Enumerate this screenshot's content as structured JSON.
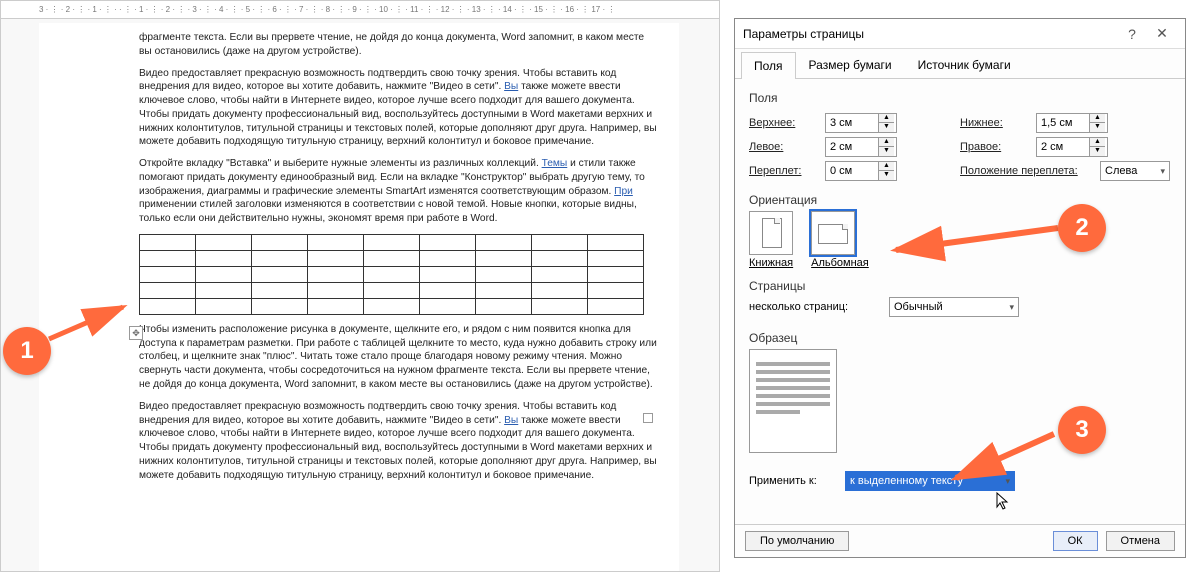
{
  "ruler": {
    "visible_marks": "3 · ⋮ · 2 · ⋮ · 1 · ⋮ ·  · ⋮ · 1 · ⋮ · 2 · ⋮ · 3 · ⋮ · 4 · ⋮ · 5 · ⋮ · 6 · ⋮ · 7 · ⋮ · 8 · ⋮ · 9 · ⋮ · 10 · ⋮ · 11 · ⋮ · 12 · ⋮ · 13 · ⋮ · 14 · ⋮ · 15 · ⋮ · 16 · ⋮ 17 · ⋮"
  },
  "document": {
    "para1": "фрагменте текста. Если вы прервете чтение, не дойдя до конца документа, Word запомнит, в каком месте вы остановились (даже на другом устройстве).",
    "para2_a": "Видео предоставляет прекрасную возможность подтвердить свою точку зрения. Чтобы вставить код внедрения для видео, которое вы хотите добавить, нажмите \"Видео в сети\". ",
    "para2_link": "Вы",
    "para2_b": " также можете ввести ключевое слово, чтобы найти в Интернете видео, которое лучше всего подходит для вашего документа. Чтобы придать документу профессиональный вид, воспользуйтесь доступными в Word макетами верхних и нижних колонтитулов, титульной страницы и текстовых полей, которые дополняют друг друга. Например, вы можете добавить подходящую титульную страницу, верхний колонтитул и боковое примечание.",
    "para3_a": "Откройте вкладку \"Вставка\" и выберите нужные элементы из различных коллекций. ",
    "para3_link": "Темы",
    "para3_b": " и стили также помогают придать документу единообразный вид. Если на вкладке \"Конструктор\" выбрать другую тему, то изображения, диаграммы и графические элементы SmartArt изменятся соответствующим образом. ",
    "para3_link2": "При",
    "para3_c": " применении стилей заголовки изменяются в соответствии с новой темой. Новые кнопки, которые видны, только если они действительно нужны, экономят время при работе в Word.",
    "para4": "Чтобы изменить расположение рисунка в документе, щелкните его, и рядом с ним появится кнопка для доступа к параметрам разметки. При работе с таблицей щелкните то место, куда нужно добавить строку или столбец, и щелкните знак \"плюс\". Читать тоже стало проще благодаря новому режиму чтения. Можно свернуть части документа, чтобы сосредоточиться на нужном фрагменте текста. Если вы прервете чтение, не дойдя до конца документа, Word запомнит, в каком месте вы остановились (даже на другом устройстве).",
    "para5_a": "Видео предоставляет прекрасную возможность подтвердить свою точку зрения. Чтобы вставить код внедрения для видео, которое вы хотите добавить, нажмите \"Видео в сети\". ",
    "para5_link": "Вы",
    "para5_b": " также можете ввести ключевое слово, чтобы найти в Интернете видео, которое лучше всего подходит для вашего документа. Чтобы придать документу профессиональный вид, воспользуйтесь доступными в Word макетами верхних и нижних колонтитулов, титульной страницы и текстовых полей, которые дополняют друг друга. Например, вы можете добавить подходящую титульную страницу, верхний колонтитул и боковое примечание."
  },
  "dialog": {
    "title": "Параметры страницы",
    "help": "?",
    "close": "✕",
    "tabs": {
      "t1": "Поля",
      "t2": "Размер бумаги",
      "t3": "Источник бумаги"
    },
    "sect_margins": "Поля",
    "top_label": "Верхнее:",
    "top_val": "3 см",
    "bottom_label": "Нижнее:",
    "bottom_val": "1,5 см",
    "left_label": "Левое:",
    "left_val": "2 см",
    "right_label": "Правое:",
    "right_val": "2 см",
    "gutter_label": "Переплет:",
    "gutter_val": "0 см",
    "gutter_pos_label": "Положение переплета:",
    "gutter_pos_val": "Слева",
    "sect_orient": "Ориентация",
    "orient_portrait": "Книжная",
    "orient_landscape": "Альбомная",
    "sect_pages": "Страницы",
    "multi_pages_label": "несколько страниц:",
    "multi_pages_val": "Обычный",
    "sect_preview": "Образец",
    "apply_label": "Применить к:",
    "apply_val": "к выделенному тексту",
    "btn_default": "По умолчанию",
    "btn_ok": "ОК",
    "btn_cancel": "Отмена"
  },
  "callouts": {
    "c1": "1",
    "c2": "2",
    "c3": "3"
  },
  "colors": {
    "accent": "#ff6a3d",
    "select": "#2a6fd6"
  }
}
